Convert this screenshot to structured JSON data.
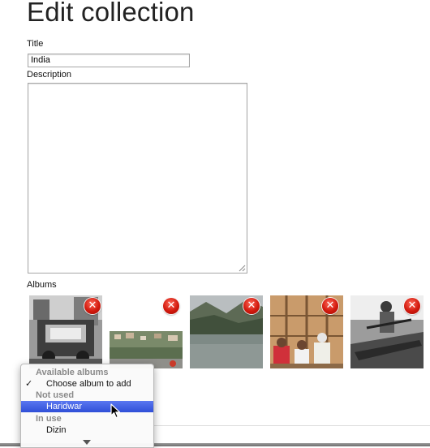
{
  "page": {
    "title": "Edit collection"
  },
  "form": {
    "title_label": "Title",
    "title_value": "India",
    "description_label": "Description",
    "description_value": "",
    "albums_label": "Albums"
  },
  "albums": [
    {
      "name": "album-1",
      "remove_symbol": "✕"
    },
    {
      "name": "album-2",
      "remove_symbol": "✕"
    },
    {
      "name": "album-3",
      "remove_symbol": "✕"
    },
    {
      "name": "album-4",
      "remove_symbol": "✕"
    },
    {
      "name": "album-5",
      "remove_symbol": "✕"
    }
  ],
  "album_dropdown": {
    "groups": {
      "available": "Available albums",
      "not_used": "Not used",
      "in_use": "In use"
    },
    "items": {
      "choose": "Choose album to add",
      "haridwar": "Haridwar",
      "dizin": "Dizin"
    },
    "check_symbol": "✓",
    "selected": "Choose album to add",
    "highlighted": "Haridwar"
  },
  "colors": {
    "highlight": "#3c5be0",
    "remove_button": "#d21a0e"
  }
}
